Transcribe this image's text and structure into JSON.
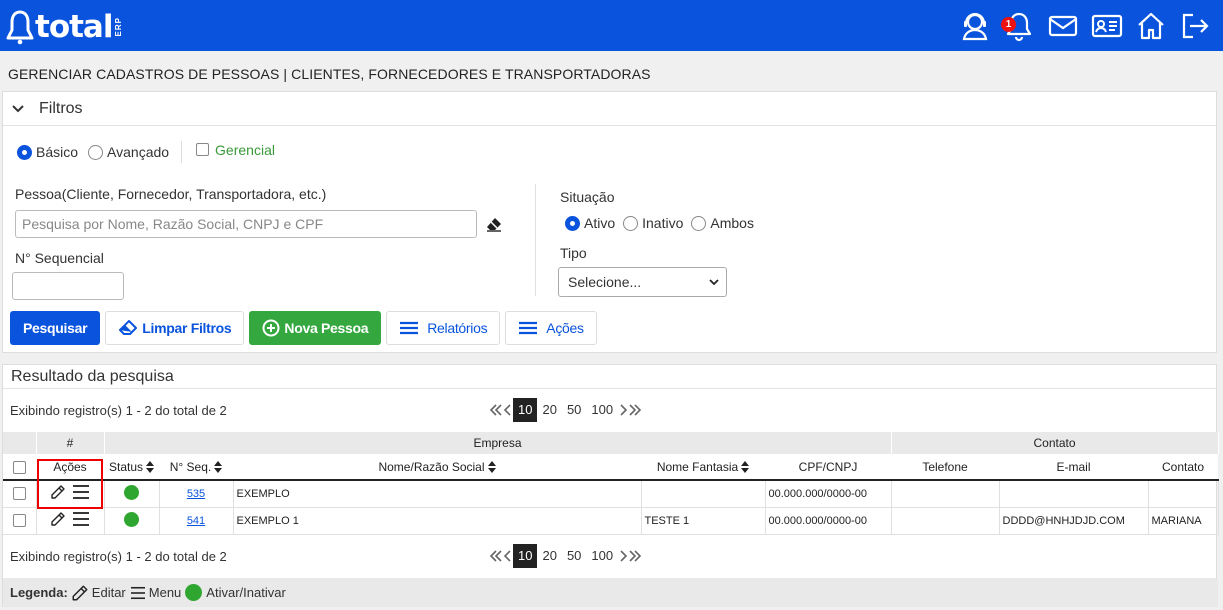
{
  "topbar": {
    "logo_text": "total",
    "logo_sub": "ERP",
    "notification_count": "1",
    "icons": [
      "support-icon",
      "bell-icon",
      "mail-icon",
      "id-card-icon",
      "home-icon",
      "logout-icon"
    ],
    "brand_color": "#0a54dd"
  },
  "page": {
    "title": "GERENCIAR CADASTROS DE PESSOAS | CLIENTES, FORNECEDORES E TRANSPORTADORAS"
  },
  "filters": {
    "title": "Filtros",
    "mode_basic": "Básico",
    "mode_advanced": "Avançado",
    "gerencial": "Gerencial",
    "pessoa_label": "Pessoa(Cliente, Fornecedor, Transportadora, etc.)",
    "pessoa_placeholder": "Pesquisa por Nome, Razão Social, CNPJ e CPF",
    "seq_label": "N° Sequencial",
    "seq_value": "",
    "situacao_label": "Situação",
    "situacao_ativo": "Ativo",
    "situacao_inativo": "Inativo",
    "situacao_ambos": "Ambos",
    "tipo_label": "Tipo",
    "tipo_selected": "Selecione..."
  },
  "buttons": {
    "pesquisar": "Pesquisar",
    "limpar": "Limpar Filtros",
    "nova": "Nova Pessoa",
    "relatorios": "Relatórios",
    "acoes": "Ações"
  },
  "results": {
    "title": "Resultado da pesquisa",
    "showing": "Exibindo registro(s) 1 - 2 do total de 2",
    "page_sizes": [
      "10",
      "20",
      "50",
      "100"
    ],
    "active_page_size": "10",
    "group_headers": {
      "hash": "#",
      "empresa": "Empresa",
      "contato": "Contato"
    },
    "columns": {
      "acoes": "Ações",
      "status": "Status",
      "seq": "N° Seq.",
      "nome": "Nome/Razão Social",
      "fantasia": "Nome Fantasia",
      "cpf": "CPF/CNPJ",
      "telefone": "Telefone",
      "email": "E-mail",
      "contato": "Contato"
    },
    "rows": [
      {
        "seq": "535",
        "nome": "EXEMPLO",
        "fantasia": "",
        "cpf": "00.000.000/0000-00",
        "telefone": "",
        "email": "",
        "contato": ""
      },
      {
        "seq": "541",
        "nome": "EXEMPLO 1",
        "fantasia": "TESTE 1",
        "cpf": "00.000.000/0000-00",
        "telefone": "",
        "email": "DDDD@HNHJDJD.COM",
        "contato": "MARIANA"
      }
    ]
  },
  "legend": {
    "title": "Legenda:",
    "editar": "Editar",
    "menu": "Menu",
    "ativar": "Ativar/Inativar"
  }
}
